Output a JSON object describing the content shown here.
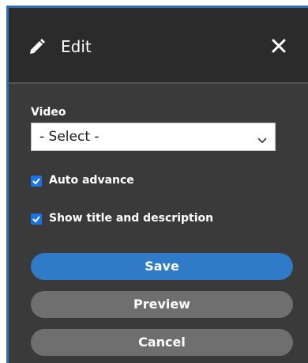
{
  "header": {
    "title": "Edit",
    "edit_icon": "pencil-icon",
    "close_icon": "close-icon"
  },
  "form": {
    "video_label": "Video",
    "video_select": {
      "value": "- Select -",
      "icon": "chevron-down-icon"
    },
    "auto_advance": {
      "label": "Auto advance",
      "checked": true
    },
    "show_title": {
      "label": "Show title and description",
      "checked": true
    }
  },
  "buttons": {
    "save": "Save",
    "preview": "Preview",
    "cancel": "Cancel"
  },
  "colors": {
    "accent": "#2f7bc7",
    "secondary_button": "#6f6f6f",
    "checkbox": "#1a73e8"
  }
}
